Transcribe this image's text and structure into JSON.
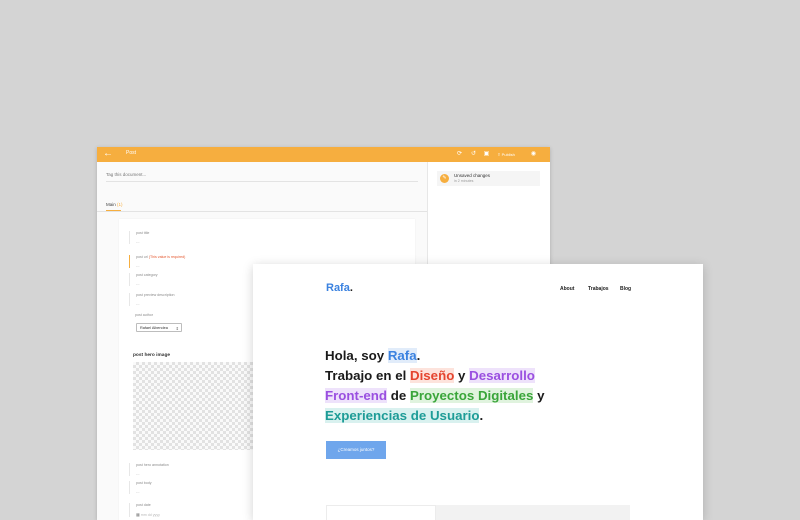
{
  "colors": {
    "accent_orange": "#f6ae3f",
    "brand_blue": "#3b82e0",
    "button_blue": "#6fa6ec"
  },
  "cms": {
    "toolbar": {
      "back_icon": "arrow-left-icon",
      "crumb": "Post",
      "icons": [
        "refresh-icon",
        "history-icon",
        "preview-icon"
      ],
      "publish_label": "Publish",
      "view_icon": "eye-icon"
    },
    "tag_placeholder": "Tag this document...",
    "tab": {
      "label": "Main",
      "count": "(1)"
    },
    "fields": [
      {
        "label": "post title",
        "required": "",
        "value": "---"
      },
      {
        "label": "post url",
        "required": "(This value is required)",
        "value": "---"
      },
      {
        "label": "post category",
        "required": "",
        "value": "---"
      },
      {
        "label": "post preview description",
        "required": "",
        "value": "---"
      }
    ],
    "author": {
      "label": "post author",
      "value": "Rafael Albendea",
      "arrow": "⇕"
    },
    "hero_image_label": "post hero image",
    "lower_fields": [
      {
        "label": "post hero annotation",
        "value": "---"
      },
      {
        "label": "post body",
        "value": "---"
      },
      {
        "label": "post date",
        "value": "mm dd yyyy"
      }
    ],
    "status": {
      "title": "Unsaved changes",
      "subtitle": "in 2 minutes"
    }
  },
  "site": {
    "logo": "Rafa",
    "logo_dot": ".",
    "nav": [
      "About",
      "Trabajos",
      "Blog"
    ],
    "headline": {
      "l1_a": "Hola, soy ",
      "l1_name": "Rafa",
      "l1_end": ".",
      "l2_a": "Trabajo en el ",
      "l2_red": "Diseño",
      "l2_b": " y ",
      "l2_purple": "Desarrollo",
      "l3_purple": "Front-end",
      "l3_a": " de ",
      "l3_green": "Proyectos Digitales",
      "l3_b": " y",
      "l4_teal": "Experiencias de Usuario",
      "l4_end": "."
    },
    "cta_label": "¿Creamos juntos?"
  }
}
